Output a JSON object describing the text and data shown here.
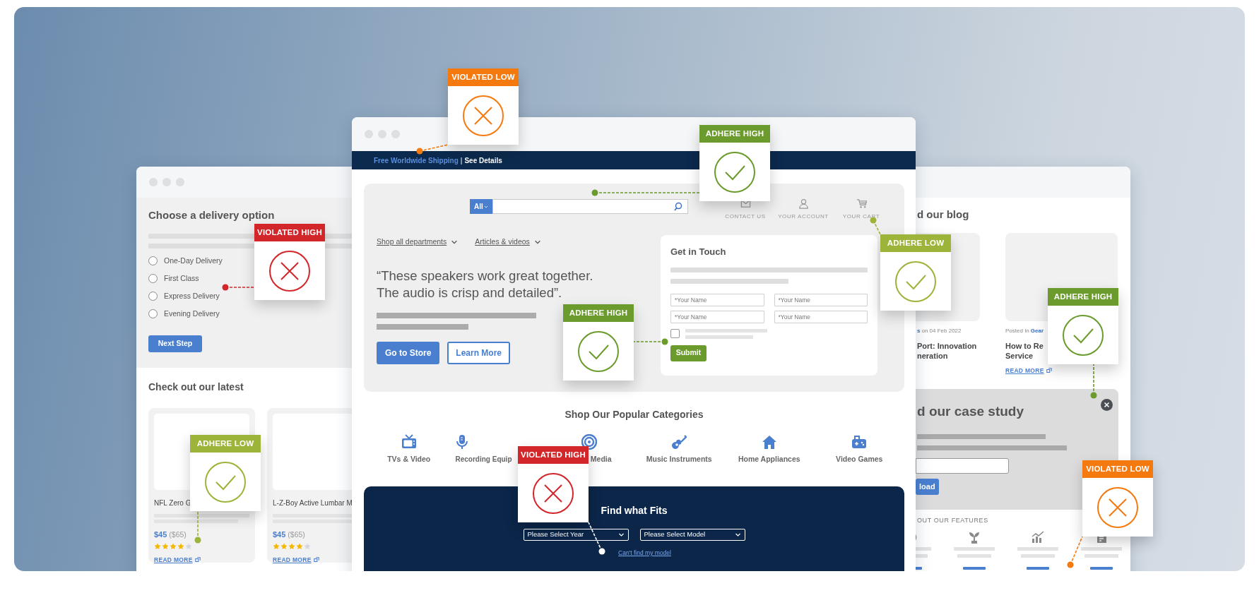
{
  "left_window": {
    "delivery": {
      "title": "Choose a delivery option",
      "options": [
        {
          "label": "One-Day Delivery",
          "selected": false
        },
        {
          "label": "First Class",
          "selected": false
        },
        {
          "label": "Express Delivery",
          "selected": false
        },
        {
          "label": "Evening Delivery",
          "selected": false
        }
      ],
      "button": "Next Step"
    },
    "latest": {
      "title": "Check out our latest",
      "products": [
        {
          "name": "NFL Zero G",
          "price": "$45",
          "old_price": "($65)",
          "stars": 4,
          "link": "READ MORE"
        },
        {
          "name": "L-Z-Boy Active Lumbar M",
          "price": "$45",
          "old_price": "($65)",
          "stars": 4,
          "link": "READ MORE"
        }
      ]
    }
  },
  "main_window": {
    "promo": {
      "offer": "Free Worldwide Shipping",
      "separator": "|",
      "details": "See Details"
    },
    "search": {
      "scope": "All"
    },
    "header_links": [
      "CONTACT US",
      "YOUR ACCOUNT",
      "YOUR CART"
    ],
    "menus": [
      "Shop all departments",
      "Articles & videos"
    ],
    "quote": "“These speakers work great together.\nThe audio is crisp and detailed”.",
    "buttons": [
      {
        "label": "Go to Store",
        "kind": "primary"
      },
      {
        "label": "Learn More",
        "kind": "outline"
      }
    ],
    "contact": {
      "title": "Get in Touch",
      "fields": [
        {
          "placeholder": "*Your Name"
        },
        {
          "placeholder": "*Your Name"
        },
        {
          "placeholder": "*Your Name"
        },
        {
          "placeholder": "*Your Name"
        }
      ],
      "checked": false,
      "submit": "Submit"
    },
    "categories": {
      "title": "Shop Our Popular Categories",
      "items": [
        "TVs & Video",
        "Recording Equip",
        "Media",
        "Music Instruments",
        "Home Appliances",
        "Video Games"
      ]
    },
    "finder": {
      "title": "Find what Fits",
      "selects": [
        "Please Select Year",
        "Please Select Model"
      ],
      "link": "Can't find my model"
    }
  },
  "right_window": {
    "blog": {
      "title": "d our blog",
      "posts": [
        {
          "category": "s",
          "meta_after": "on 04 Feb 2022",
          "title": "Port: Innovation\nneration"
        },
        {
          "meta_before": "Posted In",
          "category": "Gear",
          "title": "How to Re\nService",
          "link": "READ MORE"
        }
      ]
    },
    "case_study": {
      "title": "d our case study",
      "button": "load"
    },
    "features": {
      "title": "OUT OUR FEATURES"
    }
  },
  "badges": [
    {
      "label": "VIOLATED LOW",
      "kind": "cross",
      "color": "#f47a10",
      "on_dark": false
    },
    {
      "label": "ADHERE HIGH",
      "kind": "check",
      "color": "#6a9b2c",
      "on_dark": false
    },
    {
      "label": "VIOLATED HIGH",
      "kind": "cross",
      "color": "#d3262b",
      "on_dark": false
    },
    {
      "label": "ADHERE LOW",
      "kind": "check",
      "color": "#9cb43a",
      "on_dark": false
    },
    {
      "label": "ADHERE HIGH",
      "kind": "check",
      "color": "#6a9b2c",
      "on_dark": false
    },
    {
      "label": "ADHERE HIGH",
      "kind": "check",
      "color": "#6a9b2c",
      "on_dark": false
    },
    {
      "label": "ADHERE LOW",
      "kind": "check",
      "color": "#9cb43a",
      "on_dark": false
    },
    {
      "label": "VIOLATED HIGH",
      "kind": "cross",
      "color": "#d3262b",
      "on_dark": true
    },
    {
      "label": "VIOLATED LOW",
      "kind": "cross",
      "color": "#f47a10",
      "on_dark": false
    }
  ]
}
